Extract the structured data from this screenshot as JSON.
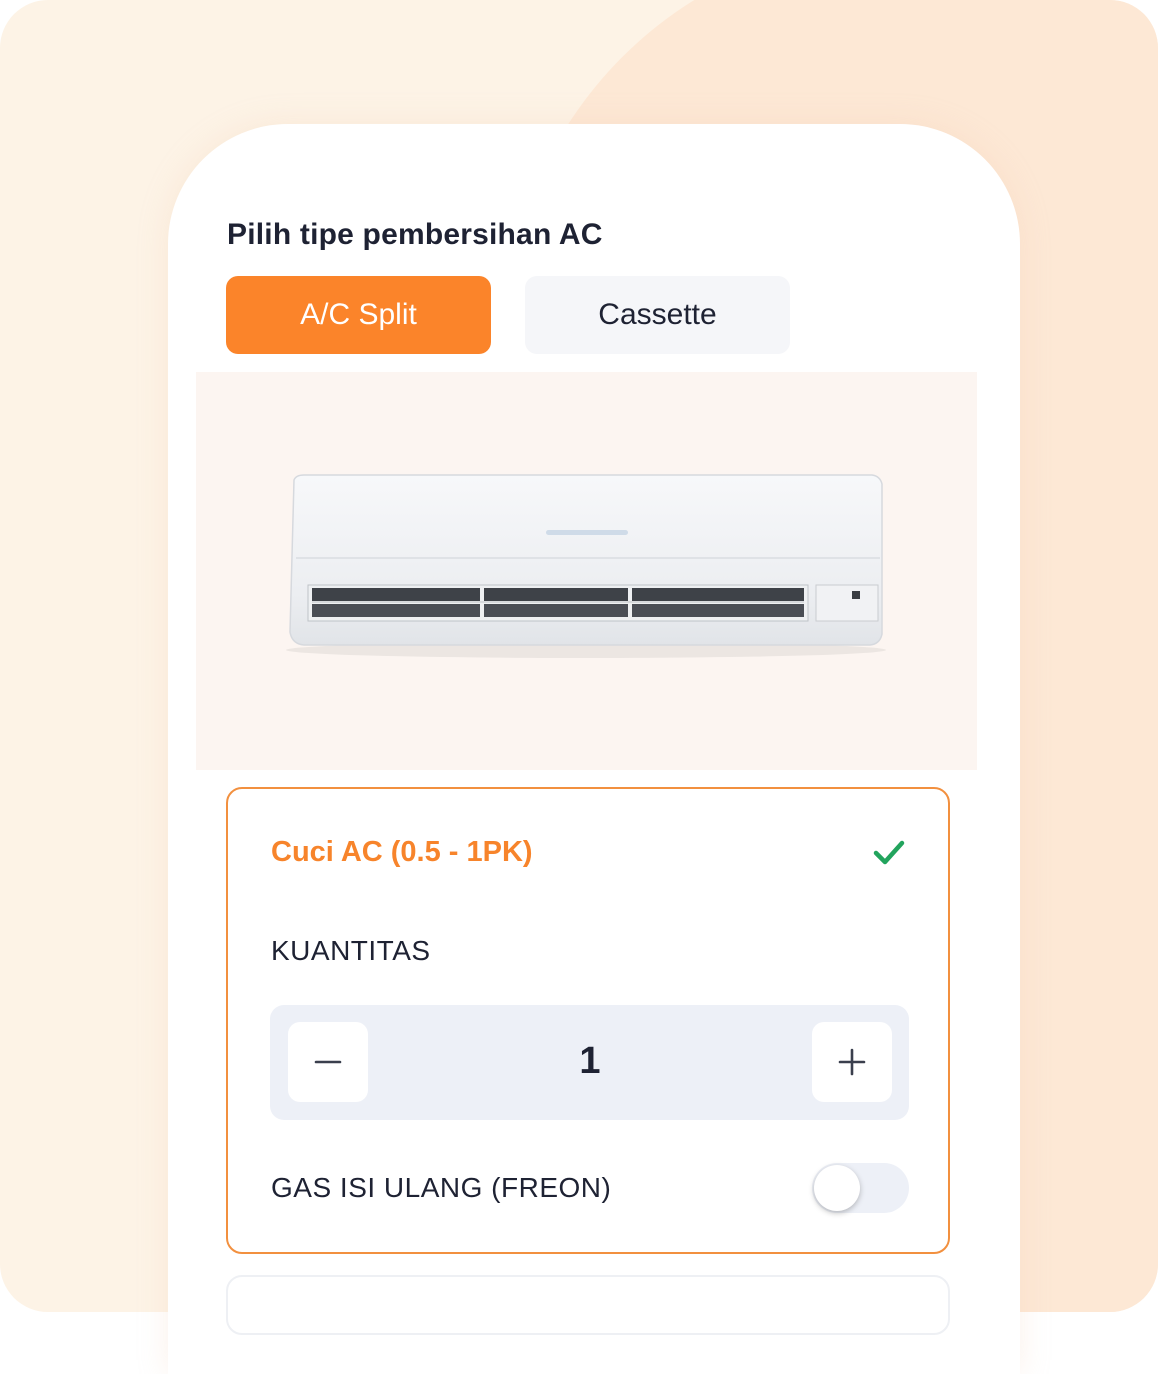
{
  "header": {
    "title": "Pilih tipe pembersihan AC"
  },
  "tabs": [
    {
      "label": "A/C Split",
      "active": true
    },
    {
      "label": "Cassette",
      "active": false
    }
  ],
  "service": {
    "name": "Cuci AC (0.5 - 1PK)",
    "selected": true,
    "quantity_label": "KUANTITAS",
    "quantity": "1",
    "gas_label": "GAS ISI ULANG (FREON)",
    "gas_enabled": false
  },
  "icons": {
    "check": "check-icon",
    "minus": "minus-icon",
    "plus": "plus-icon"
  },
  "colors": {
    "accent": "#fb842a",
    "success": "#22a45d",
    "text": "#1e2233",
    "stepper_bg": "#edf0f7"
  }
}
